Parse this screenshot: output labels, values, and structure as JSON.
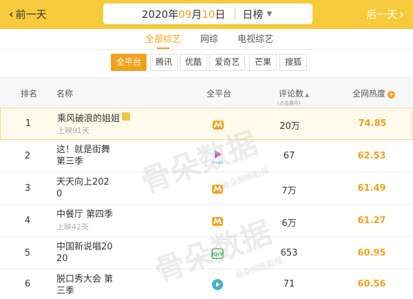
{
  "nav": {
    "prev_label": "前一天",
    "next_label": "后一天"
  },
  "date": {
    "year": "2020",
    "year_suffix": "年",
    "month": "09",
    "month_suffix": "月",
    "day": "10",
    "day_suffix": "日",
    "period": "日榜"
  },
  "tabs": [
    {
      "label": "全部综艺",
      "active": true
    },
    {
      "label": "网综",
      "active": false
    },
    {
      "label": "电视综艺",
      "active": false
    }
  ],
  "platforms": [
    {
      "label": "全平台",
      "active": true
    },
    {
      "label": "腾讯",
      "active": false
    },
    {
      "label": "优酷",
      "active": false
    },
    {
      "label": "爱奇艺",
      "active": false
    },
    {
      "label": "芒果",
      "active": false
    },
    {
      "label": "搜狐",
      "active": false
    }
  ],
  "table": {
    "headers": {
      "rank": "排名",
      "name": "名称",
      "platform": "全平台",
      "comments": "评论数",
      "comments_hint": "(点击展开)",
      "heat": "全网热度"
    },
    "rows": [
      {
        "rank": "1",
        "title": "乘风破浪的姐姐",
        "sub": "上映91天",
        "platform_icon": "mango-tv-icon",
        "comments": "20万",
        "heat": "74.85"
      },
      {
        "rank": "2",
        "title": "这！就是街舞\n第三季",
        "sub": "",
        "platform_icon": "youku-icon",
        "comments": "67",
        "heat": "62.53"
      },
      {
        "rank": "3",
        "title": "天天向上202\n0",
        "sub": "",
        "platform_icon": "mango-tv-icon",
        "comments": "7万",
        "heat": "61.49"
      },
      {
        "rank": "4",
        "title": "中餐厅 第四季",
        "sub": "上映42天",
        "platform_icon": "mango-tv-icon",
        "comments": "6万",
        "heat": "61.27"
      },
      {
        "rank": "5",
        "title": "中国新说唱20\n20",
        "sub": "",
        "platform_icon": "iqiyi-icon",
        "comments": "653",
        "heat": "60.95"
      },
      {
        "rank": "6",
        "title": "脱口秀大会 第\n三季",
        "sub": "",
        "platform_icon": "tencent-video-icon",
        "comments": "71",
        "heat": "60.56"
      }
    ]
  },
  "watermark": {
    "main": "骨朵数据",
    "sub": "骨朵网络影视"
  },
  "colors": {
    "topbar": "#f7ca3c",
    "accent": "#f0a21c",
    "first_row_bg": "#fffaec"
  }
}
